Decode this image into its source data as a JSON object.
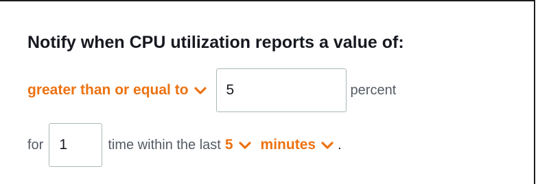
{
  "heading": "Notify when CPU utilization reports a value of:",
  "comparison": {
    "selected": "greater than or equal to",
    "icon": "chevron-down-icon"
  },
  "threshold": {
    "value": "5",
    "unit_label": "percent"
  },
  "evaluation": {
    "for_label": "for",
    "times_value": "1",
    "within_label": "time within the last",
    "period_selected": "5",
    "period_unit_selected": "minutes",
    "end_punctuation": "."
  },
  "colors": {
    "accent": "#ec7211",
    "text": "#16191f",
    "muted_text": "#545b64",
    "input_border": "#aab7b8"
  }
}
